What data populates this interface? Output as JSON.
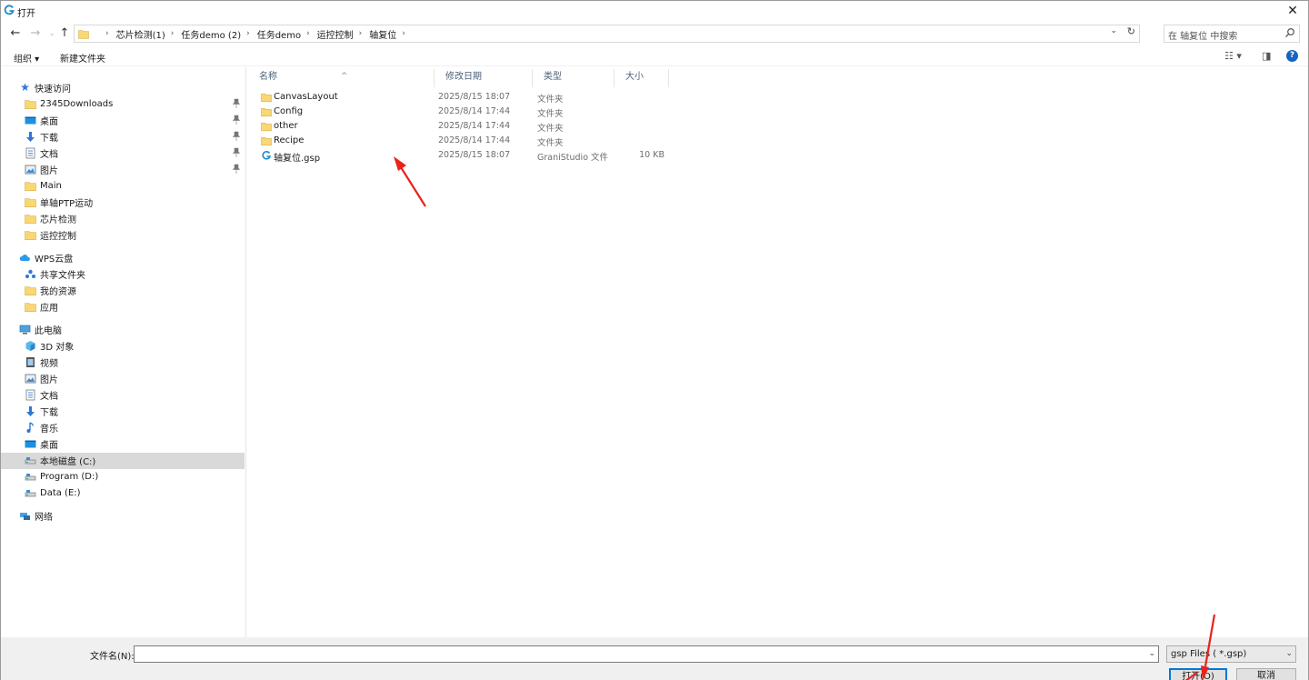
{
  "window": {
    "title": "打开"
  },
  "nav": {
    "breadcrumbs": [
      "芯片检测(1)",
      "任务demo (2)",
      "任务demo",
      "运控控制",
      "轴复位"
    ],
    "search_placeholder": "在 轴复位 中搜索"
  },
  "toolbar": {
    "organize_label": "组织 ▾",
    "new_folder_label": "新建文件夹"
  },
  "sidebar": {
    "quick_access": "快速访问",
    "quick_items": [
      {
        "label": "2345Downloads",
        "icon": "folder-icon",
        "pinned": true
      },
      {
        "label": "桌面",
        "icon": "desktop-icon",
        "pinned": true
      },
      {
        "label": "下载",
        "icon": "download-icon",
        "pinned": true
      },
      {
        "label": "文档",
        "icon": "document-icon",
        "pinned": true
      },
      {
        "label": "图片",
        "icon": "picture-icon",
        "pinned": true
      },
      {
        "label": "Main",
        "icon": "folder-icon",
        "pinned": false
      },
      {
        "label": "单轴PTP运动",
        "icon": "folder-icon",
        "pinned": false
      },
      {
        "label": "芯片检测",
        "icon": "folder-icon",
        "pinned": false
      },
      {
        "label": "运控控制",
        "icon": "folder-icon",
        "pinned": false
      }
    ],
    "wps": "WPS云盘",
    "wps_items": [
      {
        "label": "共享文件夹",
        "icon": "shared-folder-icon"
      },
      {
        "label": "我的资源",
        "icon": "folder-icon"
      },
      {
        "label": "应用",
        "icon": "folder-icon"
      }
    ],
    "this_pc": "此电脑",
    "pc_items": [
      {
        "label": "3D 对象",
        "icon": "3d-objects-icon"
      },
      {
        "label": "视频",
        "icon": "video-icon"
      },
      {
        "label": "图片",
        "icon": "picture-icon"
      },
      {
        "label": "文档",
        "icon": "document-icon"
      },
      {
        "label": "下载",
        "icon": "download-icon"
      },
      {
        "label": "音乐",
        "icon": "music-icon"
      },
      {
        "label": "桌面",
        "icon": "desktop-icon"
      },
      {
        "label": "本地磁盘 (C:)",
        "icon": "drive-icon",
        "selected": true
      },
      {
        "label": "Program (D:)",
        "icon": "drive-icon"
      },
      {
        "label": "Data (E:)",
        "icon": "drive-icon"
      }
    ],
    "network": "网络"
  },
  "columns": {
    "name": "名称",
    "modified": "修改日期",
    "type": "类型",
    "size": "大小"
  },
  "files": [
    {
      "name": "CanvasLayout",
      "modified": "2025/8/15 18:07",
      "type": "文件夹",
      "size": "",
      "icon": "folder-icon"
    },
    {
      "name": "Config",
      "modified": "2025/8/14 17:44",
      "type": "文件夹",
      "size": "",
      "icon": "folder-icon"
    },
    {
      "name": "other",
      "modified": "2025/8/14 17:44",
      "type": "文件夹",
      "size": "",
      "icon": "folder-icon"
    },
    {
      "name": "Recipe",
      "modified": "2025/8/14 17:44",
      "type": "文件夹",
      "size": "",
      "icon": "folder-icon"
    },
    {
      "name": "轴复位.gsp",
      "modified": "2025/8/15 18:07",
      "type": "GraniStudio 文件",
      "size": "10 KB",
      "icon": "granistudio-file-icon"
    }
  ],
  "bottom": {
    "filename_label": "文件名(N):",
    "filename_value": "",
    "filter_value": "gsp Files ( *.gsp)",
    "open_label": "打开(O)",
    "cancel_label": "取消"
  },
  "colors": {
    "annotation_arrow": "#e8231a",
    "folder": "#f8d775",
    "accent": "#0078d7"
  }
}
